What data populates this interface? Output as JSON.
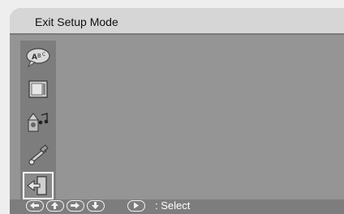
{
  "title": "Exit Setup Mode",
  "menu": {
    "items": [
      {
        "icon": "language-speech-bubble-icon"
      },
      {
        "icon": "tv-display-icon"
      },
      {
        "icon": "audio-speaker-icon"
      },
      {
        "icon": "wrench-hammer-tools-icon"
      },
      {
        "icon": "exit-door-icon",
        "selected": true
      }
    ]
  },
  "footer": {
    "keys": [
      "left-arrow-key-icon",
      "up-arrow-key-icon",
      "right-arrow-key-icon",
      "down-arrow-key-icon",
      "play-key-icon"
    ],
    "hint": ": Select"
  },
  "colors": {
    "background": "#959595",
    "title_bar": "#d6d6d6",
    "sidebar": "#7d7d7d",
    "selection": "#ffffff"
  }
}
